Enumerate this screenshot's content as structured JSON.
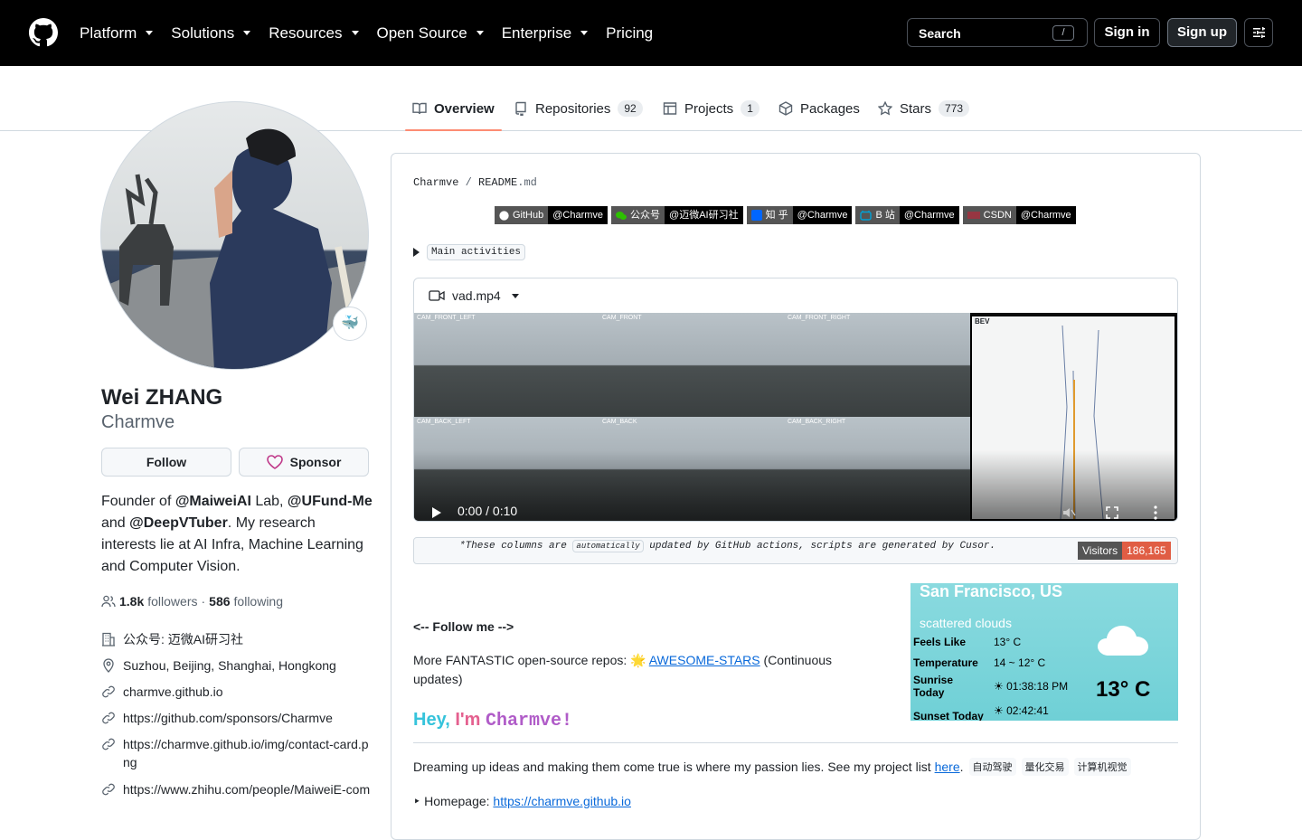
{
  "header": {
    "nav": [
      "Platform",
      "Solutions",
      "Resources",
      "Open Source",
      "Enterprise",
      "Pricing"
    ],
    "search_label": "Search",
    "search_shortcut": "/",
    "signin": "Sign in",
    "signup": "Sign up"
  },
  "tabs": [
    {
      "label": "Overview",
      "count": ""
    },
    {
      "label": "Repositories",
      "count": "92"
    },
    {
      "label": "Projects",
      "count": "1"
    },
    {
      "label": "Packages",
      "count": ""
    },
    {
      "label": "Stars",
      "count": "773"
    }
  ],
  "profile": {
    "status_emoji": "🐳",
    "name": "Wei ZHANG",
    "login": "Charmve",
    "follow": "Follow",
    "sponsor": "Sponsor",
    "bio_parts": [
      "Founder of ",
      "@MaiweiAI",
      " Lab, ",
      "@UFund-Me",
      " and ",
      "@DeepVTuber",
      ". My research interests lie at AI Infra, Machine Learning and Computer Vision."
    ],
    "followers": "1.8k",
    "followers_label": "followers",
    "sep": "·",
    "following": "586",
    "following_label": "following",
    "details": [
      {
        "icon": "building-icon",
        "text": "公众号: 迈微AI研习社"
      },
      {
        "icon": "location-icon",
        "text": "Suzhou, Beijing, Shanghai, Hongkong"
      },
      {
        "icon": "link-icon",
        "text": "charmve.github.io"
      },
      {
        "icon": "link-icon",
        "text": "https://github.com/sponsors/Charmve"
      },
      {
        "icon": "link-icon",
        "text": "https://charmve.github.io/img/contact-card.png"
      },
      {
        "icon": "link-icon",
        "text": "https://www.zhihu.com/people/MaiweiE-com"
      }
    ]
  },
  "readme": {
    "crumb_user": "Charmve",
    "crumb_sep": "/",
    "crumb_file": "README",
    "crumb_ext": ".md",
    "badges": [
      {
        "left": "GitHub",
        "right": "@Charmve",
        "color": "#000000"
      },
      {
        "left": "公众号",
        "right": "@迈微AI研习社",
        "color": "#000000"
      },
      {
        "left": "知 乎",
        "right": "@Charmve",
        "color": "#000000"
      },
      {
        "left": "B 站",
        "right": "@Charmve",
        "color": "#000000"
      },
      {
        "left": "CSDN",
        "right": "@Charmve",
        "color": "#000000"
      }
    ],
    "details_summary": "Main activities",
    "video_name": "vad.mp4",
    "cams": [
      "CAM_FRONT_LEFT",
      "CAM_FRONT",
      "CAM_FRONT_RIGHT",
      "CAM_BACK_LEFT",
      "CAM_BACK",
      "CAM_BACK_RIGHT"
    ],
    "bev_label": "BEV",
    "video_time": "0:00 / 0:10",
    "video_progress": 0.29,
    "note_pre": "*These columns are ",
    "note_code": "automatically",
    "note_post": " updated by GitHub actions, scripts are generated by Cusor.",
    "visitors_label": "Visitors",
    "visitors_count": "186,165",
    "weather": {
      "city": "San Francisco, US",
      "desc": "scattered clouds",
      "rows": [
        {
          "k": "Feels Like",
          "v": "13° C"
        },
        {
          "k": "Temperature",
          "v": "14 ~ 12° C"
        },
        {
          "k": "Sunrise Today",
          "v": "01:38:18 PM"
        },
        {
          "k": "Sunset Today",
          "v": "02:42:41"
        }
      ],
      "temp": "13° C"
    },
    "follow_me": "<-- Follow me -->",
    "more_pre": "More FANTASTIC open-source repos: ",
    "more_link": "AWESOME-STARS",
    "more_post": " (Continuous updates)",
    "hey_1": "Hey, ",
    "hey_2": "I'm ",
    "hey_3": "Charmve!",
    "dream_pre": "Dreaming up ideas and making them come true is where my passion lies. See my project list ",
    "dream_link": "here",
    "dream_post": ".",
    "dream_tags": [
      "自动驾驶",
      "量化交易",
      "计算机视觉"
    ],
    "home_pre": "‣ Homepage: ",
    "home_link": "https://charmve.github.io"
  }
}
